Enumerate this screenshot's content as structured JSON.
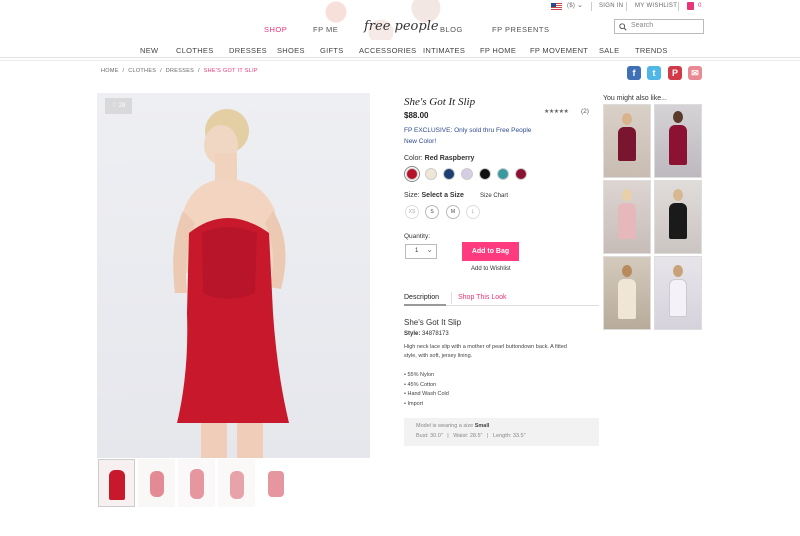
{
  "header": {
    "utility": {
      "currency": "($)",
      "sign_in": "SIGN IN",
      "wishlist": "MY WISHLIST",
      "bag_count": "0"
    },
    "topnav": {
      "shop": "SHOP",
      "fp_me": "FP ME",
      "logo": "free people",
      "blog": "BLOG",
      "fp_presents": "FP PRESENTS"
    },
    "search": {
      "placeholder": "Search"
    },
    "categories": [
      "NEW",
      "CLOTHES",
      "DRESSES",
      "SHOES",
      "GIFTS",
      "ACCESSORIES",
      "INTIMATES",
      "FP HOME",
      "FP MOVEMENT",
      "SALE",
      "TRENDS"
    ]
  },
  "breadcrumb": {
    "home": "HOME",
    "clothes": "CLOTHES",
    "dresses": "DRESSES",
    "current": "SHE'S GOT IT SLIP",
    "sep": "/"
  },
  "social": {
    "facebook": "f",
    "twitter": "t",
    "pinterest": "P",
    "email": "✉"
  },
  "image": {
    "heart_count": "29"
  },
  "product": {
    "title": "She's Got It Slip",
    "price": "$88.00",
    "rating_stars": "★★★★★",
    "review_count": "(2)",
    "exclusive_line1": "FP EXCLUSIVE: Only sold thru Free People",
    "exclusive_line2": "New Color!",
    "color_label": "Color:",
    "color_value": "Red Raspberry",
    "swatches": [
      "#b5122a",
      "#efe6d6",
      "#1d3f73",
      "#d6cce4",
      "#111111",
      "#3a9aa0",
      "#8c1233"
    ],
    "size_label": "Size:",
    "size_value": "Select a Size",
    "size_chart": "Size Chart",
    "sizes": [
      "XS",
      "S",
      "M",
      "L"
    ],
    "quantity_label": "Quantity:",
    "quantity_value": "1",
    "add_to_bag": "Add to Bag",
    "add_to_wishlist": "Add to Wishlist"
  },
  "tabs": {
    "description": "Description",
    "shop_look": "Shop This Look"
  },
  "description": {
    "title": "She's Got It Slip",
    "style_label": "Style:",
    "style_number": "34878173",
    "text_line1": "High neck lace slip with a mother of pearl buttondown back. A fitted",
    "text_line2": "style, with soft, jersey lining.",
    "bullets": [
      "55% Nylon",
      "45% Cotton",
      "Hand Wash Cold",
      "Import"
    ]
  },
  "model": {
    "line1_prefix": "Model is wearing a size",
    "line1_size": "Small",
    "bust": "Bust: 30.0\"",
    "waist": "Waist: 28.5\"",
    "length": "Length: 33.5\"",
    "sep": "|"
  },
  "sidebar": {
    "title": "You might also like..."
  },
  "colors": {
    "accent_pink": "#ff3a7f",
    "link_blue": "#2f4b8f"
  }
}
